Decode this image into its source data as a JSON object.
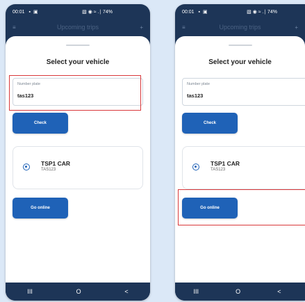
{
  "status_bar": {
    "time": "00:01",
    "left_icons": "▪ ▣",
    "right_icons": "▧ ◉ ≈ .∣ 74%",
    "battery": "74%"
  },
  "header": {
    "title": "Upcoming trips"
  },
  "sheet": {
    "title": "Select your vehicle"
  },
  "plate_field": {
    "label": "Number plate",
    "value": "tas123"
  },
  "buttons": {
    "check": "Check",
    "go_online": "Go online"
  },
  "vehicle": {
    "name": "TSP1 CAR",
    "plate": "TAS123",
    "selected": true
  },
  "nav": {
    "recents": "III",
    "home": "O",
    "back": "<"
  },
  "colors": {
    "primary_button": "#1f62b7",
    "phone_frame": "#1d3557",
    "highlight": "#d9393b",
    "background": "#dbe8f7"
  },
  "icons": [
    "menu-icon",
    "plus-icon",
    "radio-selected-icon",
    "recents-nav-icon",
    "home-nav-icon",
    "back-nav-icon"
  ]
}
